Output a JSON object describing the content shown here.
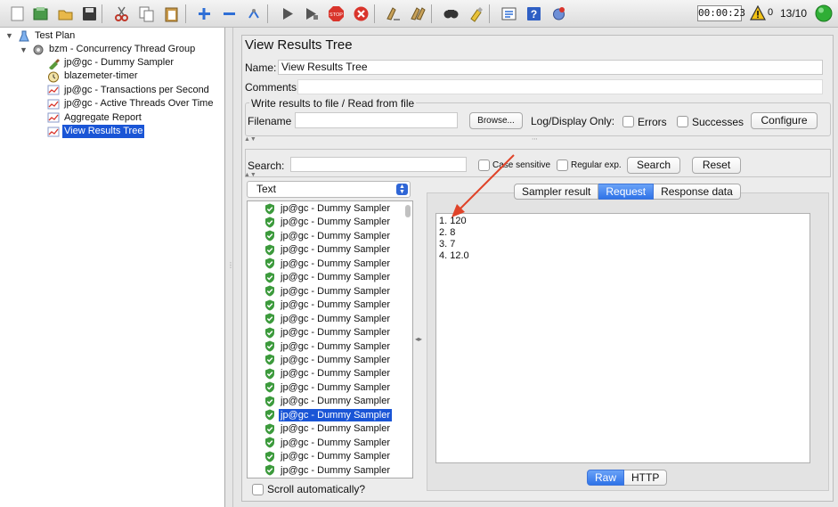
{
  "toolbar": {
    "buttons": [
      {
        "name": "new-icon"
      },
      {
        "name": "templates-icon"
      },
      {
        "name": "open-icon"
      },
      {
        "name": "save-icon"
      },
      {
        "name": "cut-icon"
      },
      {
        "name": "copy-icon"
      },
      {
        "name": "paste-icon"
      },
      {
        "name": "expand-icon"
      },
      {
        "name": "collapse-icon"
      },
      {
        "name": "toggle-icon"
      },
      {
        "name": "start-icon"
      },
      {
        "name": "start-no-pauses-icon"
      },
      {
        "name": "stop-icon"
      },
      {
        "name": "shutdown-icon"
      },
      {
        "name": "clear-icon"
      },
      {
        "name": "clear-all-icon"
      },
      {
        "name": "search-icon"
      },
      {
        "name": "reset-search-icon"
      },
      {
        "name": "function-helper-icon"
      },
      {
        "name": "help-icon"
      },
      {
        "name": "remote-icon"
      }
    ],
    "timer": "00:00:23",
    "warning_count": "0",
    "threads": "13/10"
  },
  "tree": {
    "root": "Test Plan",
    "thread_group": "bzm - Concurrency Thread Group",
    "items": [
      {
        "label": "jp@gc - Dummy Sampler",
        "icon": "sampler-icon"
      },
      {
        "label": "blazemeter-timer",
        "icon": "timer-icon"
      },
      {
        "label": "jp@gc - Transactions per Second",
        "icon": "graph-icon"
      },
      {
        "label": "jp@gc - Active Threads Over Time",
        "icon": "graph-icon"
      },
      {
        "label": "Aggregate Report",
        "icon": "graph-icon"
      },
      {
        "label": "View Results Tree",
        "icon": "graph-icon",
        "selected": true
      }
    ]
  },
  "panel": {
    "title": "View Results Tree",
    "name_label": "Name:",
    "name_value": "View Results Tree",
    "comments_label": "Comments:",
    "write_group_title": "Write results to file / Read from file",
    "filename_label": "Filename",
    "browse_label": "Browse...",
    "log_display_label": "Log/Display Only:",
    "errors_label": "Errors",
    "successes_label": "Successes",
    "configure_label": "Configure",
    "search_label": "Search:",
    "case_sensitive_label": "Case sensitive",
    "regex_label": "Regular exp.",
    "search_button": "Search",
    "reset_button": "Reset"
  },
  "results": {
    "renderer": "Text",
    "sample_label": "jp@gc - Dummy Sampler",
    "count": 20,
    "selected_index": 15,
    "scroll_auto_label": "Scroll automatically?"
  },
  "detail": {
    "tabs": [
      "Sampler result",
      "Request",
      "Response data"
    ],
    "active_tab": "Request",
    "lines": [
      "1. 120",
      "2. 8",
      "3. 7",
      "4. 12.0"
    ],
    "view_tabs": [
      "Raw",
      "HTTP"
    ],
    "active_view_tab": "Raw"
  },
  "colors": {
    "selection": "#1a55d6",
    "annotation_arrow": "#e0442a",
    "ok_shield": "#3c9a3c"
  }
}
